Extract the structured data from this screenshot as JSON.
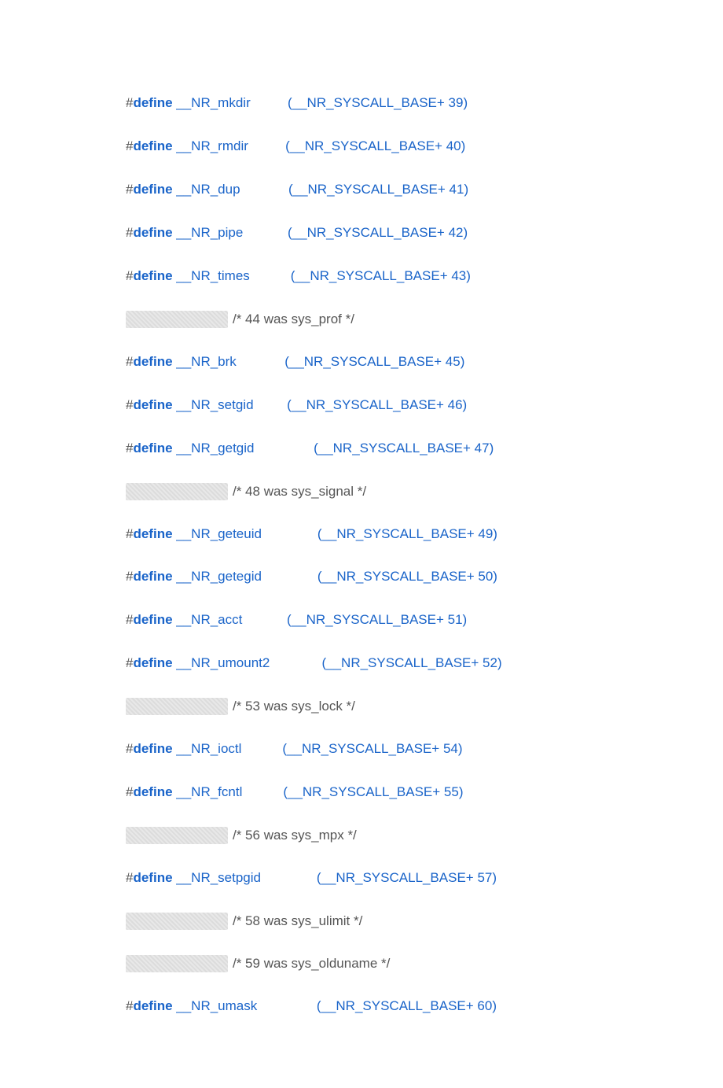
{
  "lines": [
    {
      "type": "define",
      "hash": "#",
      "keyword": "define",
      "name": " __NR_mkdir",
      "expr": "(__NR_SYSCALL_BASE+ 39)",
      "gap": "          "
    },
    {
      "type": "define",
      "hash": "#",
      "keyword": "define",
      "name": " __NR_rmdir",
      "expr": "(__NR_SYSCALL_BASE+ 40)",
      "gap": "          "
    },
    {
      "type": "define",
      "hash": "#",
      "keyword": "define",
      "name": " __NR_dup",
      "expr": "(__NR_SYSCALL_BASE+ 41)",
      "gap": "             "
    },
    {
      "type": "define",
      "hash": "#",
      "keyword": "define",
      "name": " __NR_pipe",
      "expr": "(__NR_SYSCALL_BASE+ 42)",
      "gap": "            "
    },
    {
      "type": "define",
      "hash": "#",
      "keyword": "define",
      "name": " __NR_times",
      "expr": "(__NR_SYSCALL_BASE+ 43)",
      "gap": "           "
    },
    {
      "type": "comment",
      "text": "/* 44 was sys_prof */"
    },
    {
      "type": "define",
      "hash": "#",
      "keyword": "define",
      "name": " __NR_brk",
      "expr": "(__NR_SYSCALL_BASE+ 45)",
      "gap": "             "
    },
    {
      "type": "define",
      "hash": "#",
      "keyword": "define",
      "name": " __NR_setgid",
      "expr": "(__NR_SYSCALL_BASE+ 46)",
      "gap": "         "
    },
    {
      "type": "define",
      "hash": "#",
      "keyword": "define",
      "name": " __NR_getgid",
      "expr": "(__NR_SYSCALL_BASE+ 47)",
      "gap": "                "
    },
    {
      "type": "comment",
      "text": "/* 48 was sys_signal */"
    },
    {
      "type": "define",
      "hash": "#",
      "keyword": "define",
      "name": " __NR_geteuid",
      "expr": "(__NR_SYSCALL_BASE+ 49)",
      "gap": "               "
    },
    {
      "type": "define",
      "hash": "#",
      "keyword": "define",
      "name": " __NR_getegid",
      "expr": "(__NR_SYSCALL_BASE+ 50)",
      "gap": "               "
    },
    {
      "type": "define",
      "hash": "#",
      "keyword": "define",
      "name": " __NR_acct",
      "expr": "(__NR_SYSCALL_BASE+ 51)",
      "gap": "            "
    },
    {
      "type": "define",
      "hash": "#",
      "keyword": "define",
      "name": " __NR_umount2",
      "expr": "(__NR_SYSCALL_BASE+ 52)",
      "gap": "              "
    },
    {
      "type": "comment",
      "text": "/* 53 was sys_lock */"
    },
    {
      "type": "define",
      "hash": "#",
      "keyword": "define",
      "name": " __NR_ioctl",
      "expr": "(__NR_SYSCALL_BASE+ 54)",
      "gap": "           "
    },
    {
      "type": "define",
      "hash": "#",
      "keyword": "define",
      "name": " __NR_fcntl",
      "expr": "(__NR_SYSCALL_BASE+ 55)",
      "gap": "           "
    },
    {
      "type": "comment",
      "text": "/* 56 was sys_mpx */"
    },
    {
      "type": "define",
      "hash": "#",
      "keyword": "define",
      "name": " __NR_setpgid",
      "expr": "(__NR_SYSCALL_BASE+ 57)",
      "gap": "               "
    },
    {
      "type": "comment",
      "text": "/* 58 was sys_ulimit */"
    },
    {
      "type": "comment",
      "text": "/* 59 was sys_olduname */"
    },
    {
      "type": "define",
      "hash": "#",
      "keyword": "define",
      "name": " __NR_umask",
      "expr": "(__NR_SYSCALL_BASE+ 60)",
      "gap": "                "
    }
  ]
}
